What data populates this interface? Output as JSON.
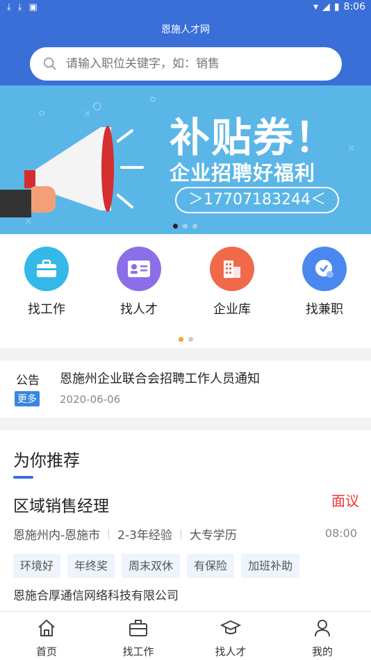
{
  "statusbar": {
    "time": "8:06"
  },
  "header": {
    "title": "恩施人才网"
  },
  "search": {
    "placeholder": "请输入职位关键字，如：销售"
  },
  "banner": {
    "title": "补贴券！",
    "subtitle": "企业招聘好福利",
    "phone": "＞17707183244＜"
  },
  "quick_menu": [
    {
      "label": "找工作",
      "icon": "briefcase-icon",
      "color": "#33b8e8"
    },
    {
      "label": "找人才",
      "icon": "id-card-icon",
      "color": "#8b6ee8"
    },
    {
      "label": "企业库",
      "icon": "building-icon",
      "color": "#f06a4a"
    },
    {
      "label": "找兼职",
      "icon": "clock-icon",
      "color": "#4a88f0"
    }
  ],
  "notice": {
    "label": "公告",
    "more": "更多",
    "title": "恩施州企业联合会招聘工作人员通知",
    "date": "2020-06-06"
  },
  "recommend": {
    "heading": "为你推荐",
    "job": {
      "title": "区域销售经理",
      "salary": "面议",
      "location": "恩施州内-恩施市",
      "experience": "2-3年经验",
      "education": "大专学历",
      "time": "08:00",
      "tags": [
        "环境好",
        "年终奖",
        "周末双休",
        "有保险",
        "加班补助"
      ],
      "company": "恩施合厚通信网络科技有限公司"
    }
  },
  "bottom_nav": [
    {
      "label": "首页",
      "icon": "home-icon"
    },
    {
      "label": "找工作",
      "icon": "briefcase-icon"
    },
    {
      "label": "找人才",
      "icon": "graduation-cap-icon"
    },
    {
      "label": "我的",
      "icon": "user-icon"
    }
  ],
  "colors": {
    "primary": "#3a6fd8",
    "banner": "#5bb6e8",
    "salary": "#e33333",
    "dot_active": "#f5a623"
  }
}
